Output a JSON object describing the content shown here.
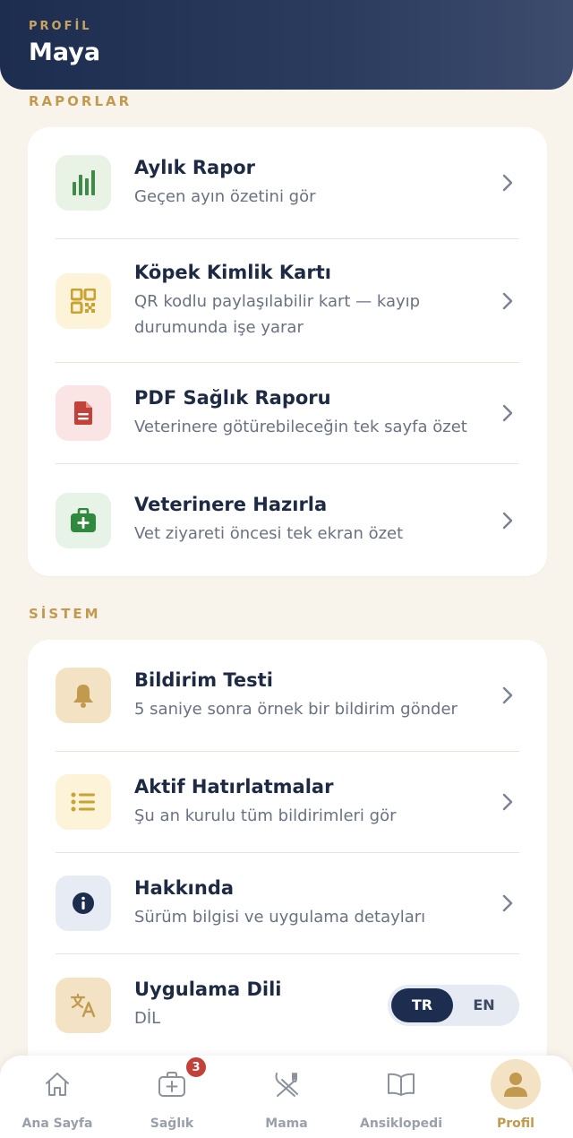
{
  "header": {
    "eyebrow": "PROFİL",
    "name": "Maya"
  },
  "reports": {
    "label": "RAPORLAR",
    "items": [
      {
        "title": "Aylık Rapor",
        "subtitle": "Geçen ayın özetini gör",
        "icon": "bar-chart-icon",
        "icon_bg": "#e8f3e6",
        "icon_color": "#3f8a48"
      },
      {
        "title": "Köpek Kimlik Kartı",
        "subtitle": "QR kodlu paylaşılabilir kart — kayıp durumunda işe yarar",
        "icon": "qr-code-icon",
        "icon_bg": "#fcf3d9",
        "icon_color": "#c9a230"
      },
      {
        "title": "PDF Sağlık Raporu",
        "subtitle": "Veterinere götürebileceğin tek sayfa özet",
        "icon": "document-icon",
        "icon_bg": "#fbe5e4",
        "icon_color": "#c2423a"
      },
      {
        "title": "Veterinere Hazırla",
        "subtitle": "Vet ziyareti öncesi tek ekran özet",
        "icon": "medical-kit-icon",
        "icon_bg": "#e6f3e6",
        "icon_color": "#2f8a3e"
      }
    ]
  },
  "system": {
    "label": "SİSTEM",
    "items": [
      {
        "title": "Bildirim Testi",
        "subtitle": "5 saniye sonra örnek bir bildirim gönder",
        "icon": "bell-icon",
        "icon_bg": "#f3e3c4",
        "icon_color": "#c29a4f"
      },
      {
        "title": "Aktif Hatırlatmalar",
        "subtitle": "Şu an kurulu tüm bildirimleri gör",
        "icon": "list-icon",
        "icon_bg": "#fcf3d9",
        "icon_color": "#c9a230"
      },
      {
        "title": "Hakkında",
        "subtitle": "Sürüm bilgisi ve uygulama detayları",
        "icon": "info-icon",
        "icon_bg": "#e7ebf4",
        "icon_color": "#1d2d4f"
      },
      {
        "title": "Uygulama Dili",
        "subtitle": "DİL",
        "icon": "translate-icon",
        "icon_bg": "#f3e3c4",
        "icon_color": "#c29a4f"
      }
    ],
    "language_options": [
      "TR",
      "EN"
    ],
    "language_selected": "TR"
  },
  "tabbar": {
    "items": [
      {
        "label": "Ana Sayfa",
        "icon": "home-icon"
      },
      {
        "label": "Sağlık",
        "icon": "medical-plus-icon",
        "badge": "3"
      },
      {
        "label": "Mama",
        "icon": "fork-knife-icon"
      },
      {
        "label": "Ansiklopedi",
        "icon": "book-icon"
      },
      {
        "label": "Profil",
        "icon": "person-icon",
        "active": true
      }
    ]
  },
  "colors": {
    "navy": "#1d2d4f",
    "gold": "#c29a4f",
    "background": "#f8f4ec",
    "badge": "#c2423a"
  }
}
